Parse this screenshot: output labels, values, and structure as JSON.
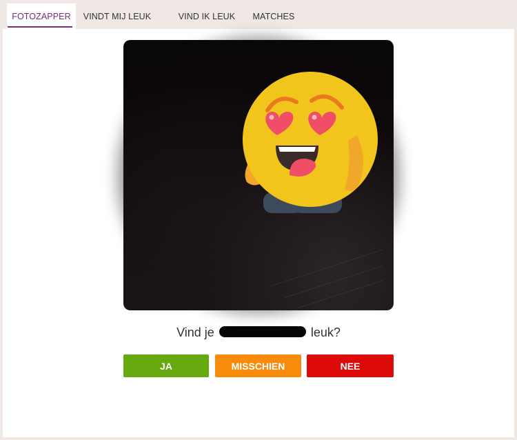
{
  "tabs": [
    {
      "label": "FOTOZAPPER",
      "active": true
    },
    {
      "label": "VINDT MIJ LEUK",
      "active": false
    },
    {
      "label": "VIND IK LEUK",
      "active": false
    },
    {
      "label": "MATCHES",
      "active": false
    }
  ],
  "colors": {
    "accent": "#7b2a78",
    "yes": "#66aa10",
    "maybe": "#f88a0c",
    "no": "#dd0a0a"
  },
  "card": {
    "overlay_icon": "heart-eyes-emoji-icon",
    "question_prefix": "Vind je",
    "question_suffix": "leuk?"
  },
  "actions": {
    "yes_label": "JA",
    "maybe_label": "MISSCHIEN",
    "no_label": "NEE"
  }
}
